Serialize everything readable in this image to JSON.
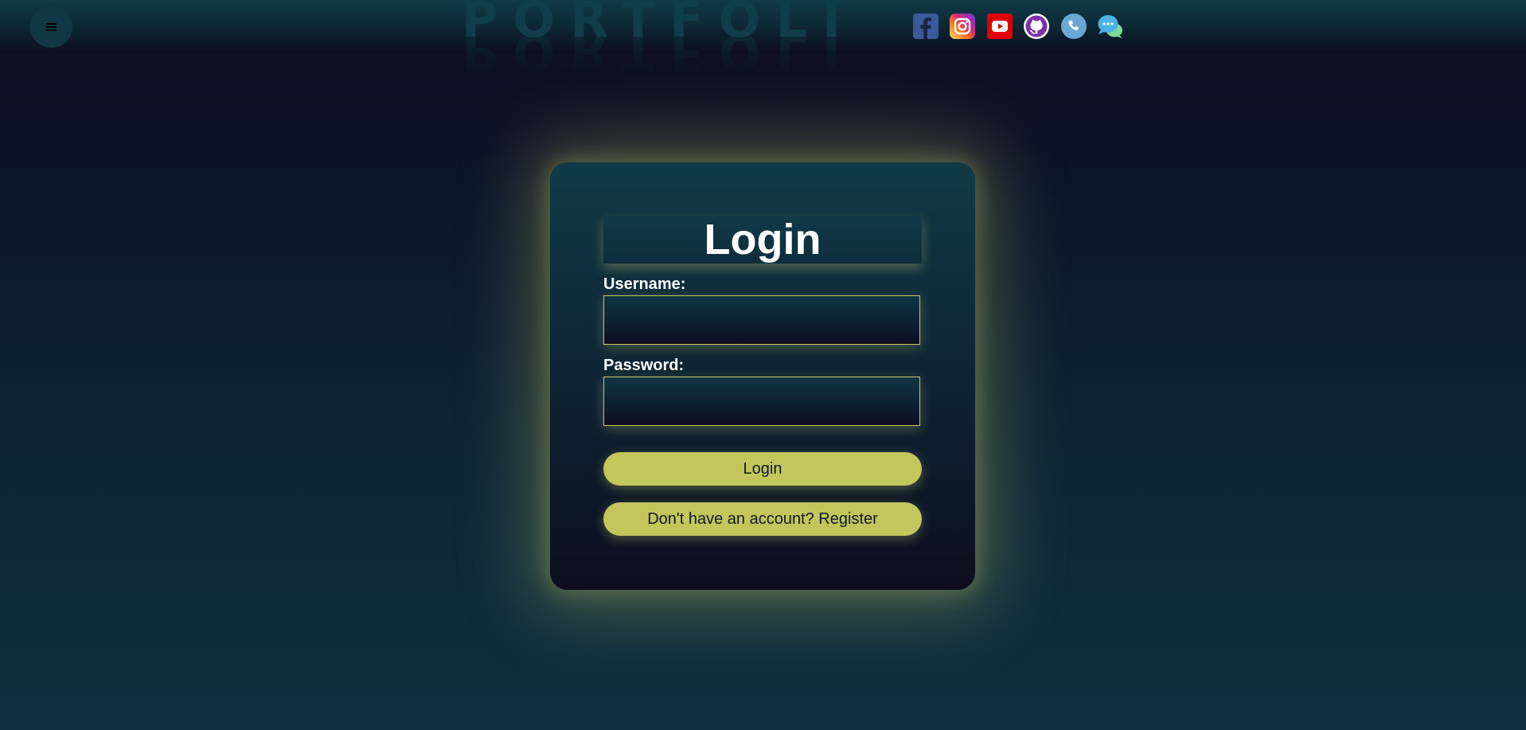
{
  "header": {
    "menu_icon": "hamburger-menu-icon",
    "brand": "PORTFOLIO",
    "social_links": [
      {
        "name": "facebook",
        "icon": "facebook-icon",
        "color": "#3b5998"
      },
      {
        "name": "instagram",
        "icon": "instagram-icon",
        "color": "#e1306c"
      },
      {
        "name": "youtube",
        "icon": "youtube-icon",
        "color": "#e00000"
      },
      {
        "name": "github",
        "icon": "github-icon",
        "color": "#8a3ab9"
      },
      {
        "name": "phone",
        "icon": "phone-icon",
        "color": "#6aa8d3"
      },
      {
        "name": "chat",
        "icon": "chat-icon",
        "color": "#4ab4e8"
      }
    ]
  },
  "login": {
    "title": "Login",
    "username_label": "Username:",
    "username_value": "",
    "password_label": "Password:",
    "password_value": "",
    "login_button": "Login",
    "register_button": "Don't have an account? Register"
  },
  "theme": {
    "accent": "#c3c65b",
    "background_dark": "#0c0e1f",
    "background_teal": "#0e3040"
  }
}
